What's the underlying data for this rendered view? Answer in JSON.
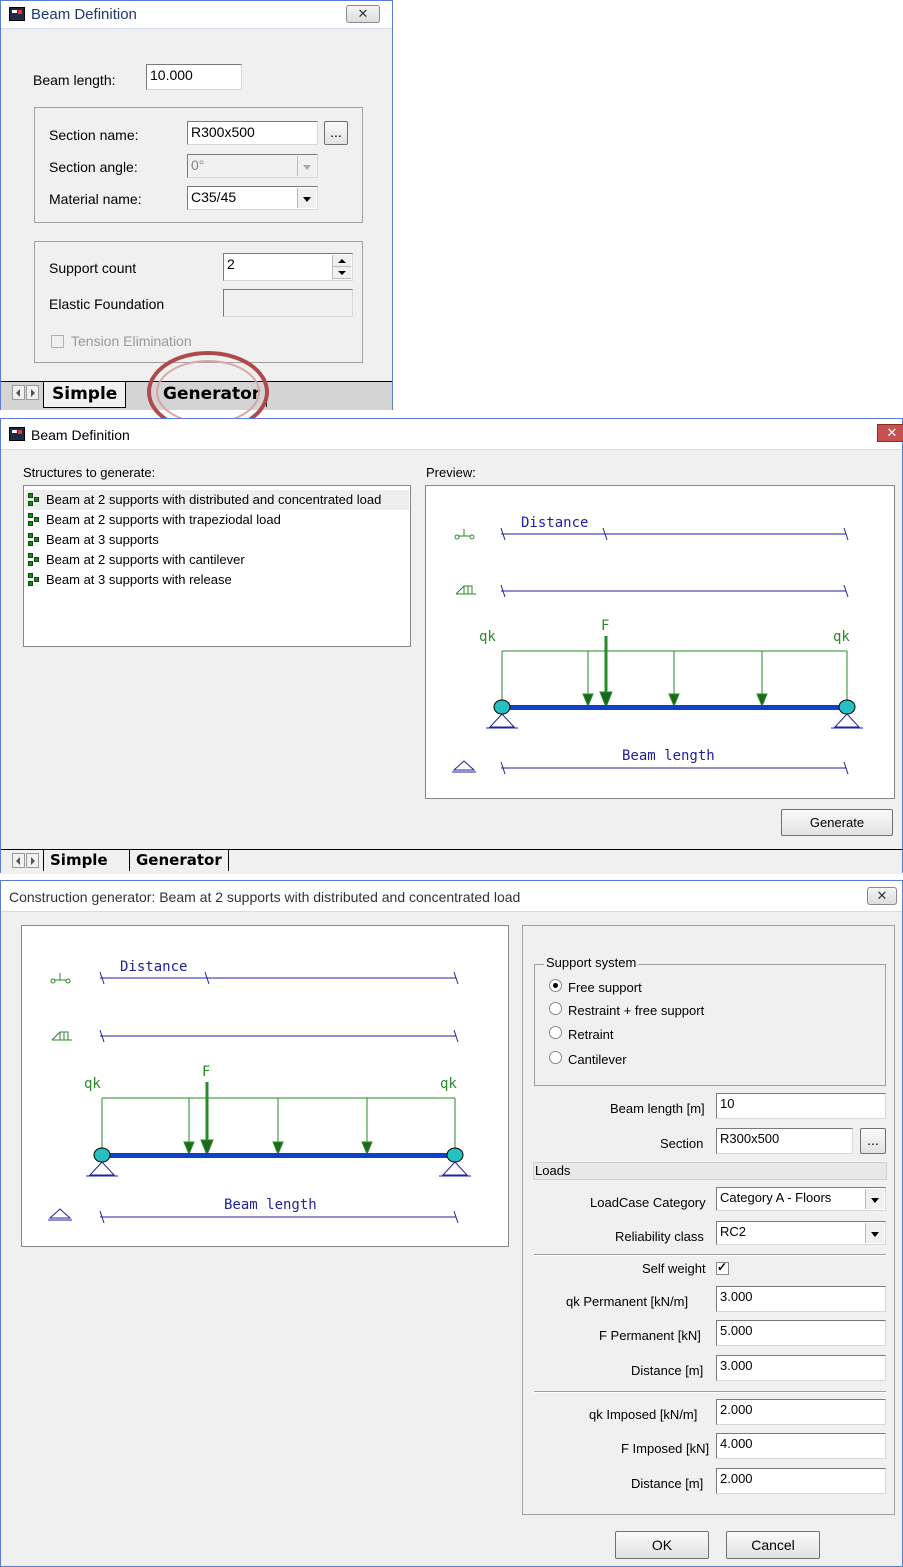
{
  "simple_window": {
    "title": "Beam Definition",
    "close_glyph": "✕",
    "beam_length_label": "Beam length:",
    "beam_length_value": "10.000",
    "section_name_label": "Section name:",
    "section_name_value": "R300x500",
    "browse_label": "...",
    "section_angle_label": "Section angle:",
    "section_angle_value": "0°",
    "material_name_label": "Material name:",
    "material_name_value": "C35/45",
    "support_count_label": "Support count",
    "support_count_value": "2",
    "elastic_foundation_label": "Elastic Foundation",
    "elastic_foundation_value": "",
    "tension_elimination_label": "Tension Elimination",
    "tabs": [
      "Simple",
      "Generator"
    ],
    "highlight_color": "#b04a4a"
  },
  "generator_window": {
    "title": "Beam Definition",
    "structures_label": "Structures to generate:",
    "preview_label": "Preview:",
    "structures": [
      "Beam at 2 supports with distributed and concentrated load",
      "Beam at 2 supports with trapeziodal load",
      "Beam at 3 supports",
      "Beam at 2 supports with cantilever",
      "Beam at 3 supports with release"
    ],
    "generate_button": "Generate",
    "tabs": [
      "Simple",
      "Generator"
    ]
  },
  "diagram": {
    "distance_label": "Distance",
    "qk_left": "qk",
    "qk_right": "qk",
    "force_label": "F",
    "beam_length_label": "Beam length",
    "beam_color": "#1040d0",
    "load_color": "#2a8a2a",
    "dimension_color": "#2020a0"
  },
  "construction_window": {
    "title": "Construction generator: Beam at 2 supports with distributed and concentrated load",
    "support_system_label": "Support system",
    "support_options": [
      "Free support",
      "Restraint + free support",
      "Retraint",
      "Cantilever"
    ],
    "support_selected": "Free support",
    "beam_length_label": "Beam length [m]",
    "beam_length_value": "10",
    "section_label": "Section",
    "section_value": "R300x500",
    "browse_label": "...",
    "loads_label": "Loads",
    "loadcase_category_label": "LoadCase Category",
    "loadcase_category_value": "Category A - Floors",
    "reliability_class_label": "Reliability class",
    "reliability_class_value": "RC2",
    "self_weight_label": "Self weight",
    "self_weight_checked": true,
    "qk_permanent_label": "qk Permanent [kN/m]",
    "qk_permanent_value": "3.000",
    "f_permanent_label": "F Permanent [kN]",
    "f_permanent_value": "5.000",
    "distance_permanent_label": "Distance [m]",
    "distance_permanent_value": "3.000",
    "qk_imposed_label": "qk Imposed [kN/m]",
    "qk_imposed_value": "2.000",
    "f_imposed_label": "F Imposed [kN]",
    "f_imposed_value": "4.000",
    "distance_imposed_label": "Distance [m]",
    "distance_imposed_value": "2.000",
    "ok_button": "OK",
    "cancel_button": "Cancel"
  }
}
